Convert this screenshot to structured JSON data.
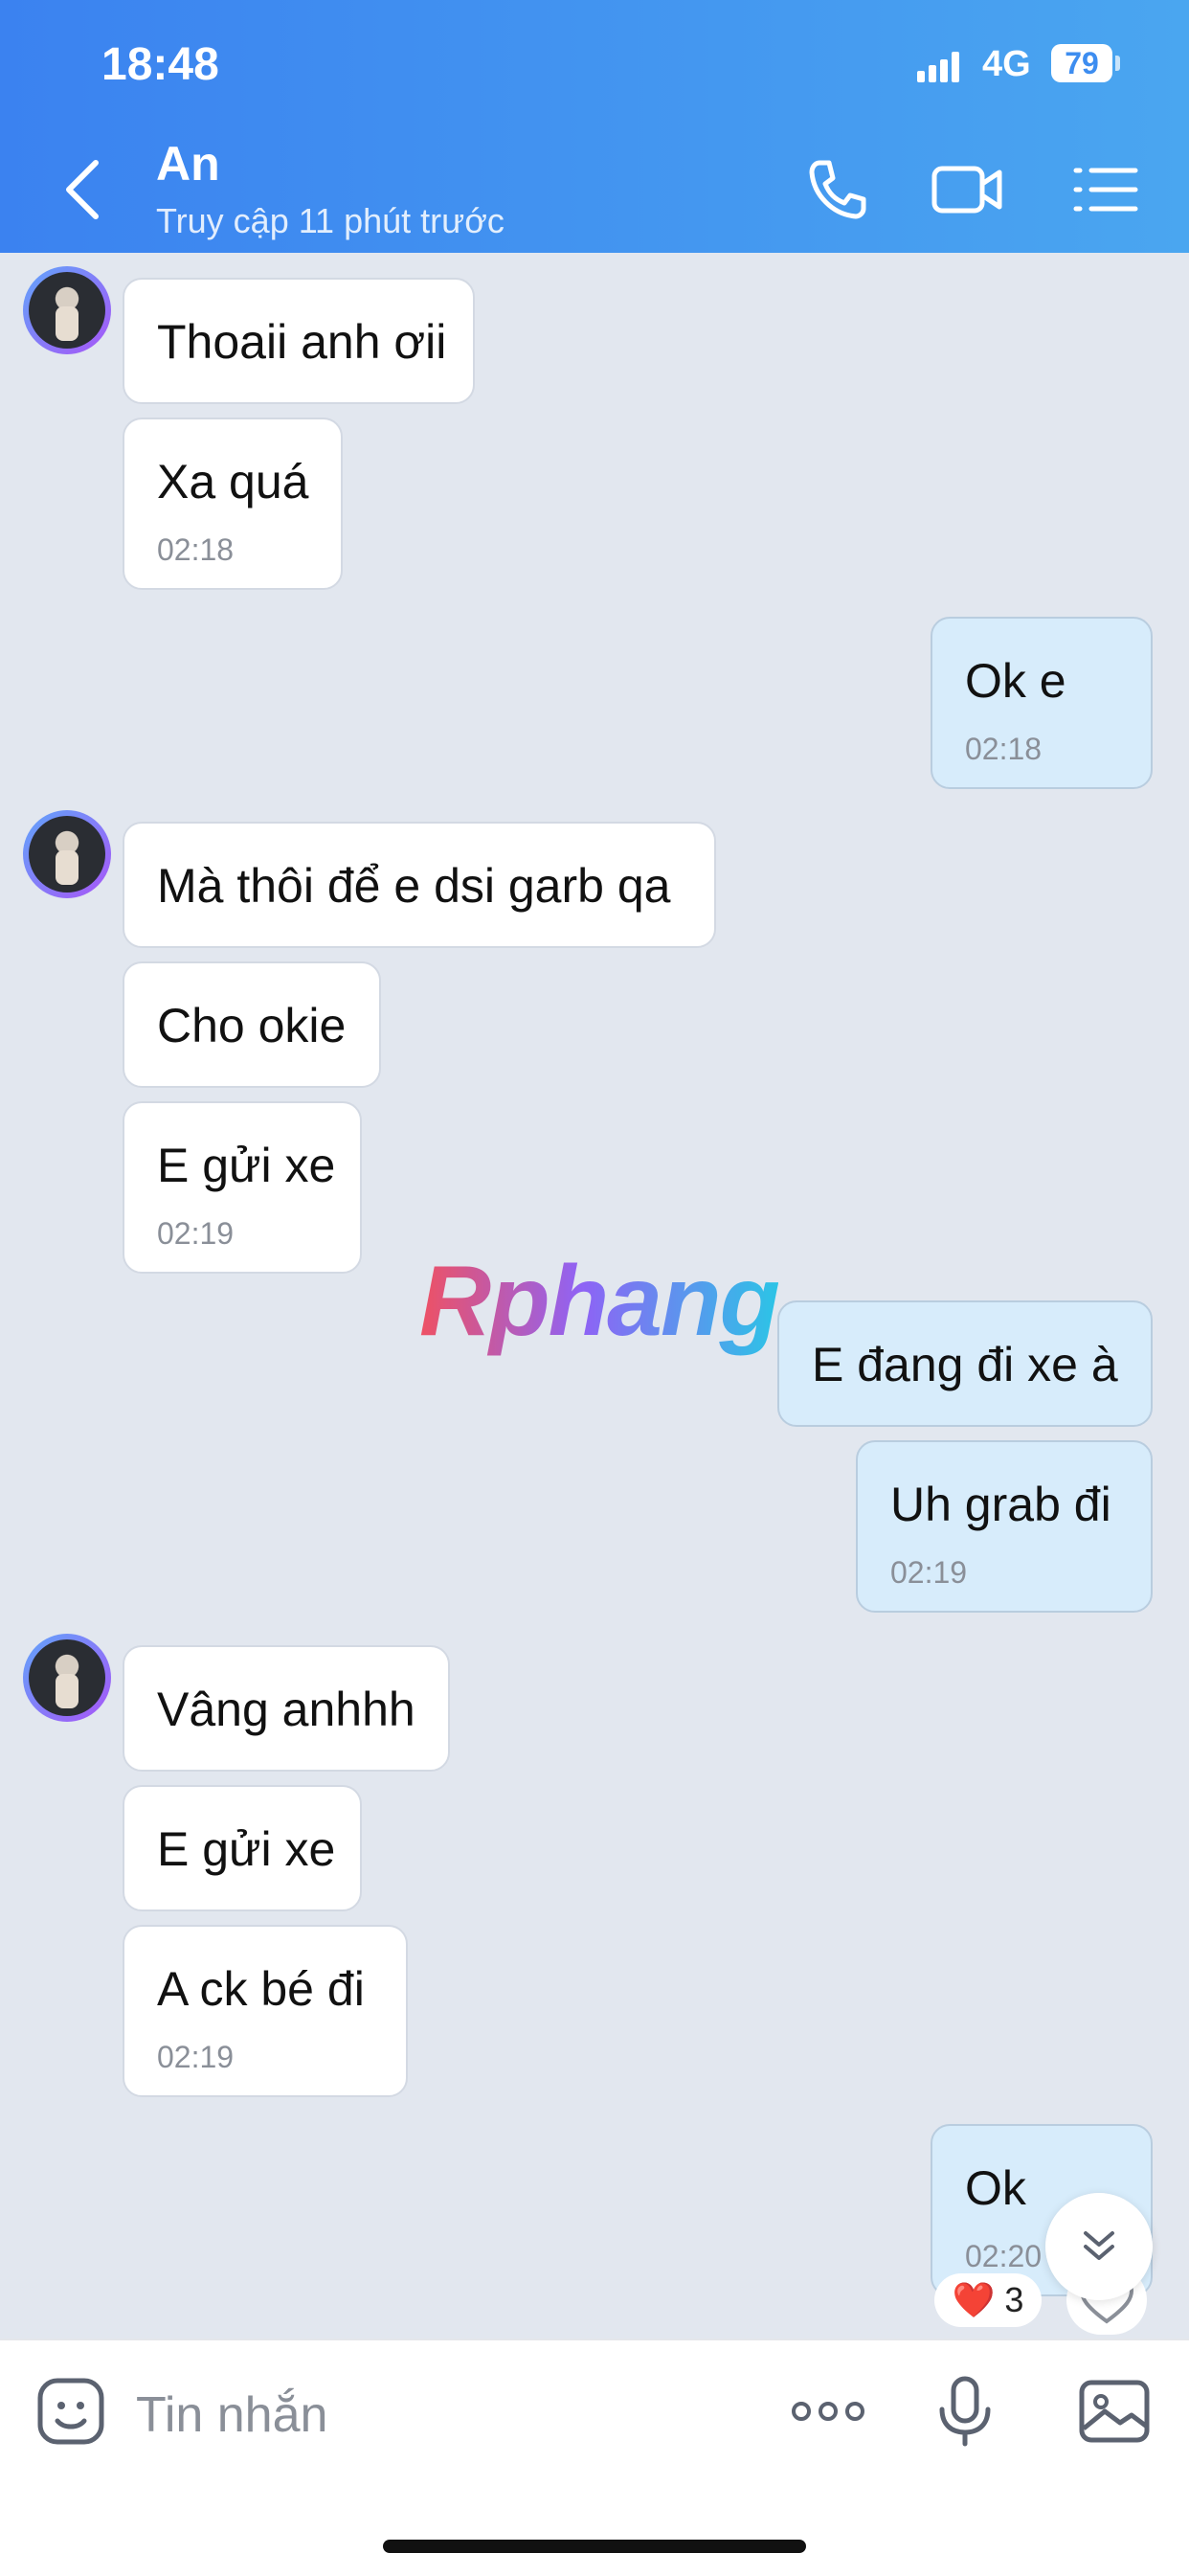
{
  "status": {
    "time": "18:48",
    "network": "4G",
    "battery": "79"
  },
  "header": {
    "name": "An",
    "subtitle": "Truy cập 11 phút trước"
  },
  "messages": [
    {
      "text": "Thoaii anh ơii"
    },
    {
      "text": "Xa quá",
      "time": "02:18"
    },
    {
      "text": "Ok e",
      "time": "02:18"
    },
    {
      "text": "Mà thôi để e dsi garb qa"
    },
    {
      "text": "Cho okie"
    },
    {
      "text": "E gửi xe",
      "time": "02:19"
    },
    {
      "text": "E đang đi xe à"
    },
    {
      "text": "Uh grab đi",
      "time": "02:19"
    },
    {
      "text": "Vâng anhhh"
    },
    {
      "text": "E gửi xe"
    },
    {
      "text": "A ck bé đi",
      "time": "02:19"
    },
    {
      "text": "Ok",
      "time": "02:20"
    }
  ],
  "watermark": "Rphang",
  "reaction": {
    "emoji": "❤️",
    "count": "3"
  },
  "input": {
    "placeholder": "Tin nhắn"
  },
  "icons": {
    "back": "back-arrow-icon",
    "call": "phone-icon",
    "video": "video-camera-icon",
    "menu": "list-menu-icon",
    "sticker": "sticker-icon",
    "more": "more-dots-icon",
    "mic": "microphone-icon",
    "image": "image-icon",
    "scroll": "double-chevron-down-icon",
    "react": "heart-outline-icon"
  },
  "colors": {
    "header_start": "#3b82f0",
    "header_end": "#4aa6f0",
    "bubble_in": "#ffffff",
    "bubble_out": "#d7ecfb",
    "background": "#e2e7ef"
  }
}
